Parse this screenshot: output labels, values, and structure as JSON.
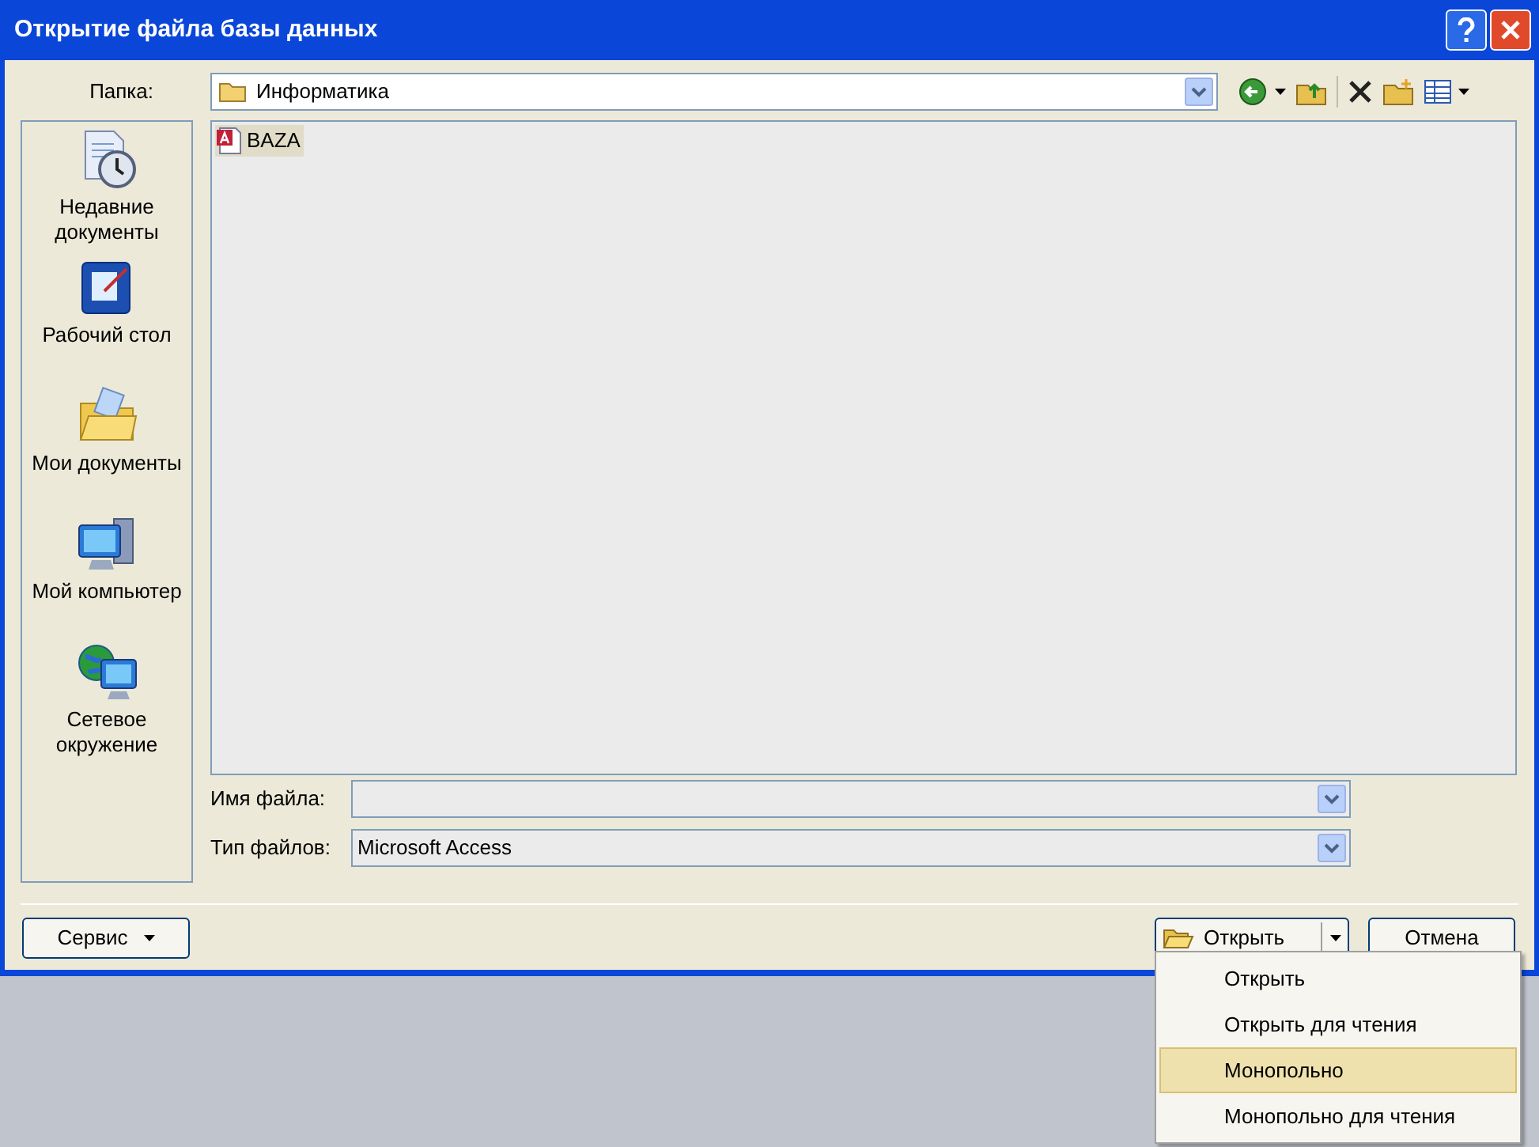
{
  "window": {
    "title": "Открытие файла базы данных"
  },
  "folder": {
    "label": "Папка:",
    "value": "Информатика"
  },
  "places": [
    {
      "label": "Недавние документы",
      "kind": "recent"
    },
    {
      "label": "Рабочий стол",
      "kind": "desktop"
    },
    {
      "label": "Мои документы",
      "kind": "documents"
    },
    {
      "label": "Мой компьютер",
      "kind": "computer"
    },
    {
      "label": "Сетевое окружение",
      "kind": "network"
    }
  ],
  "files": [
    {
      "name": "BAZA",
      "selected": true
    }
  ],
  "file_name": {
    "label": "Имя файла:"
  },
  "file_type": {
    "label": "Тип файлов:",
    "value": "Microsoft Access"
  },
  "buttons": {
    "tools": "Сервис",
    "open": "Открыть",
    "cancel": "Отмена"
  },
  "open_menu": [
    {
      "label": "Открыть",
      "selected": false
    },
    {
      "label": "Открыть для чтения",
      "selected": false
    },
    {
      "label": "Монопольно",
      "selected": true
    },
    {
      "label": "Монопольно для чтения",
      "selected": false
    }
  ]
}
